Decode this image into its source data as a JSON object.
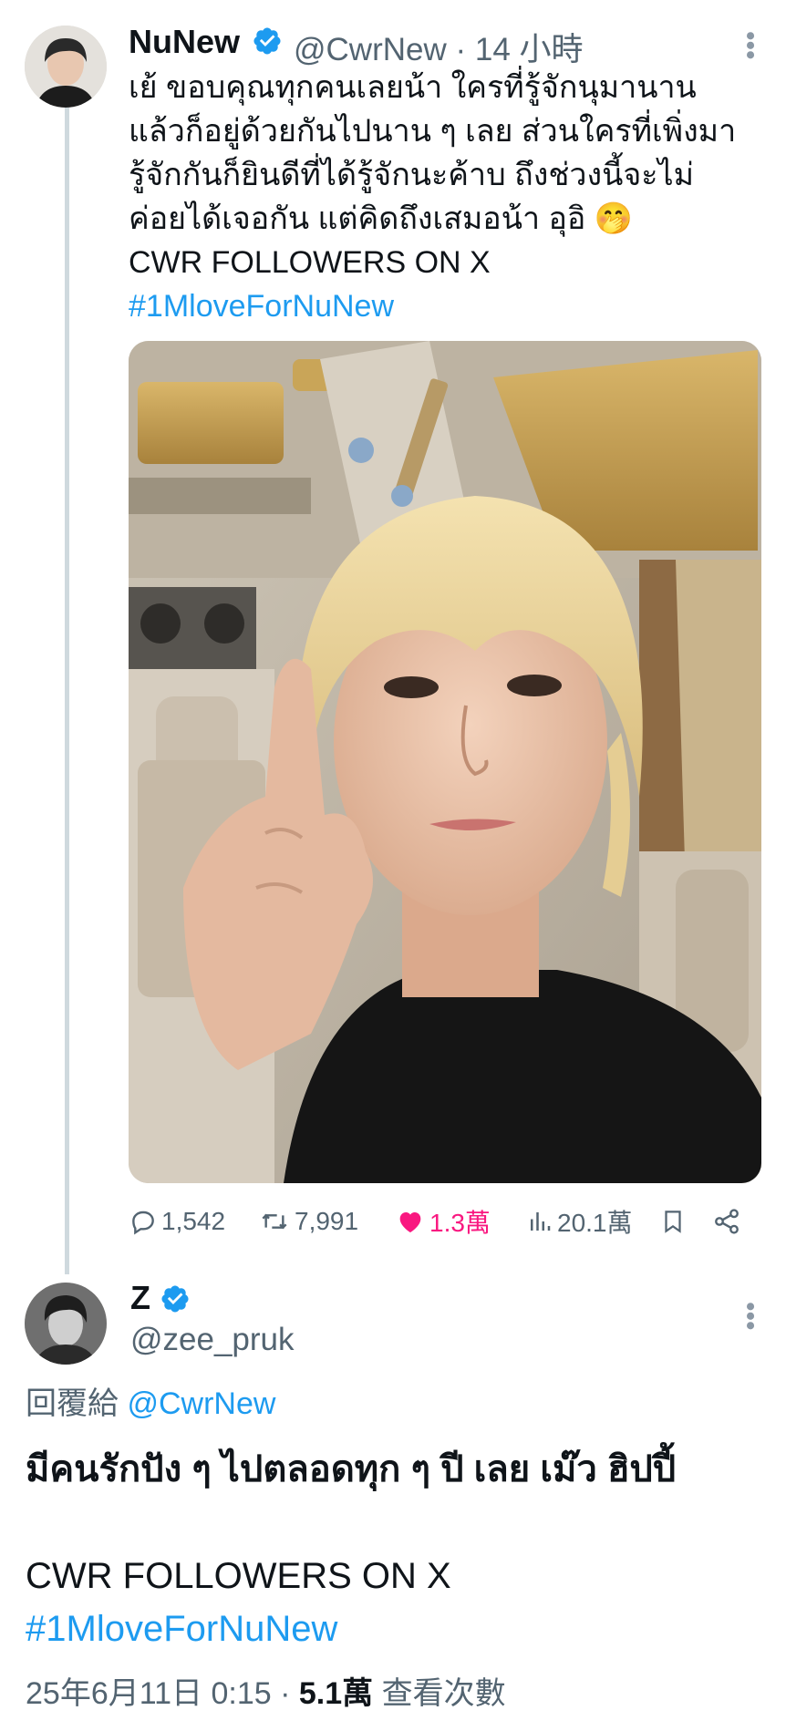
{
  "tweet": {
    "author_name": "NuNew",
    "author_handle": "@CwrNew",
    "time": "· 14 小時",
    "text_lines": [
      "เย้ ขอบคุณทุกคนเลยน้า ใครที่รู้จักนุมานาน",
      "แล้วก็อยู่ด้วยกันไปนาน ๆ เลย ส่วนใครที่เพิ่งมา",
      "รู้จักกันก็ยินดีที่ได้รู้จักนะค้าบ ถึงช่วงนี้จะไม่",
      "ค่อยได้เจอกัน แต่คิดถึงเสมอน้า อุอิ"
    ],
    "emoji": "🤭",
    "line_caps": "CWR FOLLOWERS ON X",
    "hashtag": "#1MloveForNuNew",
    "stats": {
      "replies": "1,542",
      "retweets": "7,991",
      "likes": "1.3萬",
      "views": "20.1萬"
    },
    "like_color": "#f91880"
  },
  "reply": {
    "author_name": "Z",
    "author_handle": "@zee_pruk",
    "replying_to_label": "回覆給",
    "replying_to_handle": "@CwrNew",
    "text": "มีคนรักปัง ๆ ไปตลอดทุก ๆ ปี เลย เม๊ว ฮิปปี้",
    "line_caps": "CWR FOLLOWERS ON X",
    "hashtag": "#1MloveForNuNew",
    "timestamp": "25年6月11日 0:15 ·",
    "views_count": "5.1萬",
    "views_label": "查看次數"
  },
  "icons": [
    "verified-badge-icon",
    "more-options-icon",
    "reply-icon",
    "retweet-icon",
    "heart-icon",
    "views-icon",
    "bookmark-icon",
    "share-icon"
  ],
  "accent_color": "#1d9bf0"
}
